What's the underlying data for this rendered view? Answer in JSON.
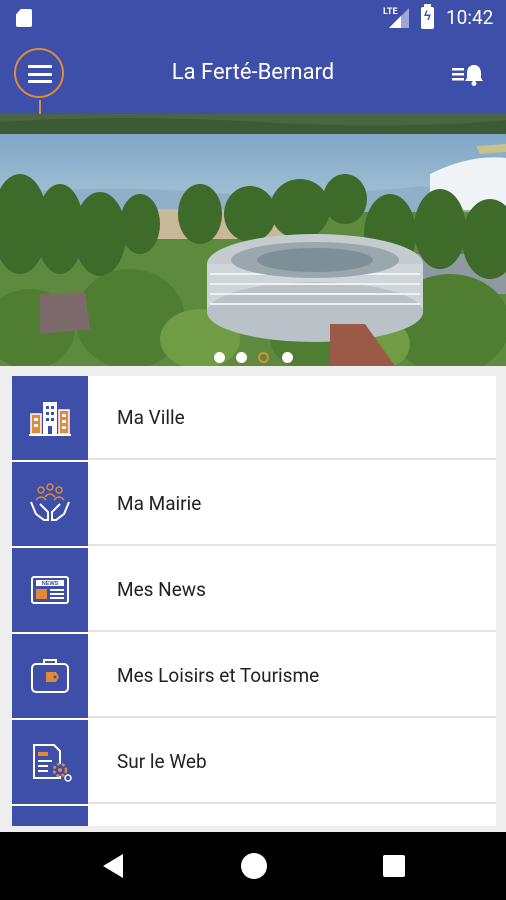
{
  "status_bar": {
    "network": "LTE",
    "time": "10:42"
  },
  "app_bar": {
    "title": "La Ferté-Bernard",
    "menu_icon": "hamburger-menu-icon",
    "notifications_icon": "notification-list-bell-icon"
  },
  "carousel": {
    "slide_count": 4,
    "active_index": 2
  },
  "menu": {
    "items": [
      {
        "label": "Ma Ville",
        "icon": "city-buildings-icon"
      },
      {
        "label": "Ma Mairie",
        "icon": "hands-people-icon"
      },
      {
        "label": "Mes News",
        "icon": "newspaper-icon"
      },
      {
        "label": "Mes Loisirs et Tourisme",
        "icon": "suitcase-tag-icon"
      },
      {
        "label": "Sur le Web",
        "icon": "web-settings-icon"
      },
      {
        "label": "",
        "icon": ""
      }
    ]
  },
  "colors": {
    "primary": "#3d4fa8",
    "accent": "#e08a3c"
  }
}
